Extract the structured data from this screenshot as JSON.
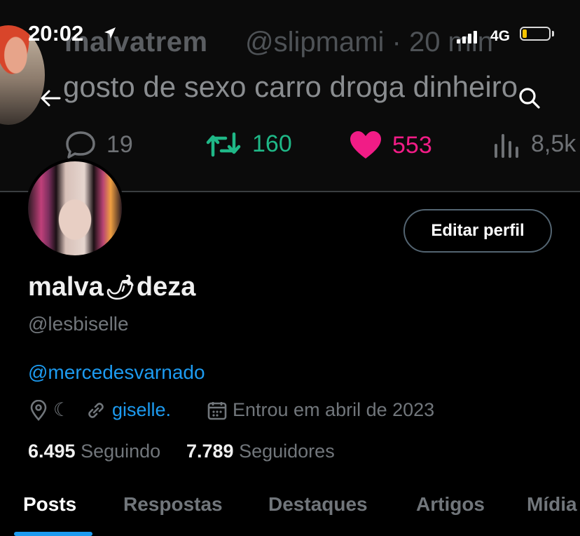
{
  "status_bar": {
    "time": "20:02",
    "network": "4G",
    "battery_level": 0.1
  },
  "banner_tweet": {
    "name": "malvatrem",
    "handle_time": "@slipmami · 20 min",
    "text": "gosto de sexo carro droga dinheiro",
    "replies": "19",
    "retweets": "160",
    "likes": "553",
    "views": "8,5k",
    "colors": {
      "retweet": "#1fb887",
      "like": "#f11c86"
    }
  },
  "profile": {
    "name_prefix": "malva",
    "name_emoji": "🌶",
    "name_suffix": "deza",
    "handle": "@lesbiselle",
    "bio_mention": "@mercedesvarnado",
    "location": "☾",
    "website": "giselle.",
    "joined": "Entrou em abril de 2023",
    "following_count": "6.495",
    "following_label": "Seguindo",
    "followers_count": "7.789",
    "followers_label": "Seguidores",
    "edit_button": "Editar perfil"
  },
  "tabs": [
    {
      "label": "Posts",
      "active": true
    },
    {
      "label": "Respostas",
      "active": false
    },
    {
      "label": "Destaques",
      "active": false
    },
    {
      "label": "Artigos",
      "active": false
    },
    {
      "label": "Mídia",
      "active": false
    }
  ],
  "colors": {
    "accent": "#1d9bf0",
    "muted": "#71767b",
    "background": "#000000"
  }
}
